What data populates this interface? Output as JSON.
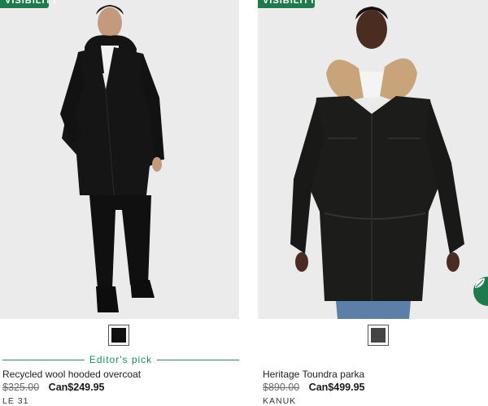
{
  "products": [
    {
      "badge": "VISIBILITY",
      "swatch_color": "#111111",
      "editor_pick": "Editor's pick",
      "name": "Recycled wool hooded overcoat",
      "old_price": "$325.00",
      "new_price": "Can$249.95",
      "brand": "LE 31"
    },
    {
      "badge": "VISIBILITY",
      "swatch_color": "#444444",
      "name": "Heritage Toundra parka",
      "old_price": "$890.00",
      "new_price": "Can$499.95",
      "brand": "KANUK"
    }
  ],
  "colors": {
    "accent": "#1f8a58",
    "badge": "#1f7a4d"
  },
  "floating_button_icon": "leaf-icon"
}
